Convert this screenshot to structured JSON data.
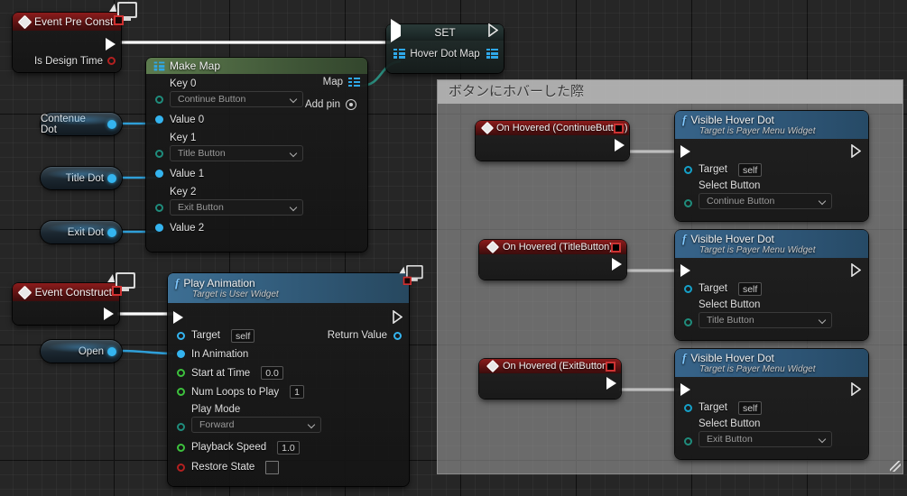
{
  "editor": {
    "name": "unreal-blueprint-graph",
    "background_color": "#262626",
    "grid_color": "#303030"
  },
  "comment_box": {
    "title": "ボタンにホバーした際",
    "fill_color": "#969696",
    "title_color": "#b2b2b2"
  },
  "nodes": {
    "event_pre_construct": {
      "title": "Event Pre Construct",
      "output_exec": "",
      "pins": [
        {
          "label": "Is Design Time",
          "type": "boolean"
        }
      ]
    },
    "make_map": {
      "title": "Make Map",
      "map_label": "Map",
      "add_pin_label": "Add pin",
      "entries": [
        {
          "key_label": "Key 0",
          "key_value": "Continue Button",
          "value_label": "Value 0"
        },
        {
          "key_label": "Key 1",
          "key_value": "Title Button",
          "value_label": "Value 1"
        },
        {
          "key_label": "Key 2",
          "key_value": "Exit Button",
          "value_label": "Value 2"
        }
      ]
    },
    "set_node": {
      "title": "SET",
      "variable": "Hover Dot Map"
    },
    "event_construct": {
      "title": "Event Construct"
    },
    "play_animation": {
      "title": "Play Animation",
      "subtitle": "Target is User Widget",
      "return_label": "Return Value",
      "rows": [
        {
          "label": "Target",
          "value": "self",
          "kind": "value",
          "pin": "blue"
        },
        {
          "label": "In Animation",
          "value": "",
          "kind": "none",
          "pin": "blue-filled"
        },
        {
          "label": "Start at Time",
          "value": "0.0",
          "kind": "value",
          "pin": "green"
        },
        {
          "label": "Num Loops to Play",
          "value": "1",
          "kind": "value",
          "pin": "green"
        },
        {
          "label": "Play Mode",
          "value": "Forward",
          "kind": "combo",
          "pin": "teal"
        },
        {
          "label": "Playback Speed",
          "value": "1.0",
          "kind": "value",
          "pin": "green"
        },
        {
          "label": "Restore State",
          "value": "",
          "kind": "checkbox",
          "pin": "red"
        }
      ]
    },
    "variables": [
      {
        "label": "Contenue Dot"
      },
      {
        "label": "Title Dot"
      },
      {
        "label": "Exit Dot"
      },
      {
        "label": "Open"
      }
    ],
    "hover_events": [
      {
        "title": "On Hovered (ContinueButton)"
      },
      {
        "title": "On Hovered (TitleButton)"
      },
      {
        "title": "On Hovered (ExitButton)"
      }
    ],
    "visible_hover_dots": [
      {
        "title": "Visible Hover Dot",
        "subtitle": "Target is Payer Menu Widget",
        "target_label": "Target",
        "target_value": "self",
        "select_label": "Select Button",
        "select_value": "Continue Button"
      },
      {
        "title": "Visible Hover Dot",
        "subtitle": "Target is Payer Menu Widget",
        "target_label": "Target",
        "target_value": "self",
        "select_label": "Select Button",
        "select_value": "Title Button"
      },
      {
        "title": "Visible Hover Dot",
        "subtitle": "Target is Payer Menu Widget",
        "target_label": "Target",
        "target_value": "self",
        "select_label": "Select Button",
        "select_value": "Exit Button"
      }
    ]
  },
  "colors": {
    "exec_wire": "#ffffff",
    "data_wire_blue": "#2f9fd8",
    "data_wire_teal": "#2a8a7c",
    "event_header": "#7c1919",
    "function_header": "#34607f",
    "map_header": "#4f6c43"
  }
}
